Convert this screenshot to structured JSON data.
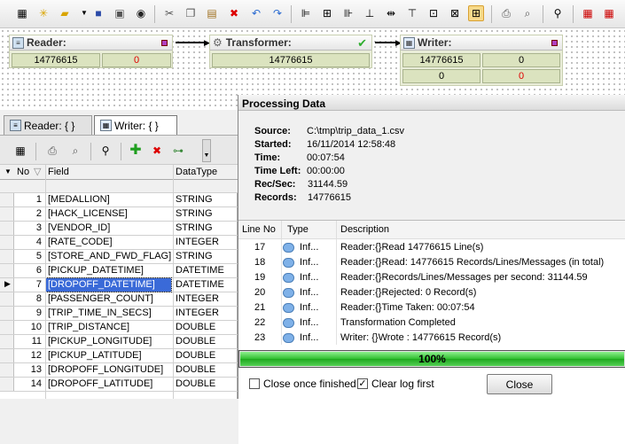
{
  "toolbar": {
    "icons": [
      "properties-icon",
      "new-icon",
      "open-icon",
      "save-icon",
      "save-as-icon",
      "deploy-icon",
      "cut-icon",
      "copy-icon",
      "paste-icon",
      "delete-icon",
      "undo-icon",
      "redo-icon",
      "align-left-icon",
      "align-center-icon",
      "align-right-icon",
      "align-bottom-icon",
      "distribute-h-icon",
      "align-top-icon",
      "distribute-v-icon",
      "size-icon",
      "fit-icon",
      "print-icon",
      "print-preview-icon",
      "find-icon",
      "calendar-icon",
      "calendar-2-icon"
    ]
  },
  "canvas": {
    "reader": {
      "title": "Reader:",
      "count": "14776615",
      "errors": "0"
    },
    "transformer": {
      "title": "Transformer:",
      "count": "14776615"
    },
    "writer": {
      "title": "Writer:",
      "count": "14776615",
      "c2": "0",
      "c3": "0",
      "c4": "0"
    }
  },
  "tabs": [
    {
      "label": "Reader: { }"
    },
    {
      "label": "Writer: { }"
    }
  ],
  "grid": {
    "headers": {
      "no": "No",
      "field": "Field",
      "type": "DataType"
    },
    "rows": [
      {
        "no": "1",
        "field": "[MEDALLION]",
        "type": "STRING"
      },
      {
        "no": "2",
        "field": "[HACK_LICENSE]",
        "type": "STRING"
      },
      {
        "no": "3",
        "field": "[VENDOR_ID]",
        "type": "STRING"
      },
      {
        "no": "4",
        "field": "[RATE_CODE]",
        "type": "INTEGER"
      },
      {
        "no": "5",
        "field": "[STORE_AND_FWD_FLAG]",
        "type": "STRING"
      },
      {
        "no": "6",
        "field": "[PICKUP_DATETIME]",
        "type": "DATETIME"
      },
      {
        "no": "7",
        "field": "[DROPOFF_DATETIME]",
        "type": "DATETIME"
      },
      {
        "no": "8",
        "field": "[PASSENGER_COUNT]",
        "type": "INTEGER"
      },
      {
        "no": "9",
        "field": "[TRIP_TIME_IN_SECS]",
        "type": "INTEGER"
      },
      {
        "no": "10",
        "field": "[TRIP_DISTANCE]",
        "type": "DOUBLE"
      },
      {
        "no": "11",
        "field": "[PICKUP_LONGITUDE]",
        "type": "DOUBLE"
      },
      {
        "no": "12",
        "field": "[PICKUP_LATITUDE]",
        "type": "DOUBLE"
      },
      {
        "no": "13",
        "field": "[DROPOFF_LONGITUDE]",
        "type": "DOUBLE"
      },
      {
        "no": "14",
        "field": "[DROPOFF_LATITUDE]",
        "type": "DOUBLE"
      }
    ]
  },
  "dialog": {
    "title": "Processing Data",
    "source_label": "Source:",
    "source": "C:\\tmp\\trip_data_1.csv",
    "started_label": "Started:",
    "started": "16/11/2014 12:58:48",
    "time_label": "Time:",
    "time": "00:07:54",
    "left_label": "Time Left:",
    "left": "00:00:00",
    "rec_label": "Rec/Sec:",
    "rec": "31144.59",
    "records_label": "Records:",
    "records": "14776615",
    "log_headers": {
      "line": "Line No",
      "type": "Type",
      "desc": "Description"
    },
    "log": [
      {
        "line": "17",
        "type": "Inf...",
        "desc": "Reader:{}Read 14776615 Line(s)"
      },
      {
        "line": "18",
        "type": "Inf...",
        "desc": "Reader:{}Read: 14776615 Records/Lines/Messages (in total)"
      },
      {
        "line": "19",
        "type": "Inf...",
        "desc": "Reader:{}Records/Lines/Messages per second: 31144.59"
      },
      {
        "line": "20",
        "type": "Inf...",
        "desc": "Reader:{}Rejected: 0 Record(s)"
      },
      {
        "line": "21",
        "type": "Inf...",
        "desc": "Reader:{}Time Taken: 00:07:54"
      },
      {
        "line": "22",
        "type": "Inf...",
        "desc": "Transformation Completed"
      },
      {
        "line": "23",
        "type": "Inf...",
        "desc": "Writer: {}Wrote : 14776615 Record(s)"
      }
    ],
    "progress": "100%",
    "progress_value": 1.0,
    "close_once_label": "Close once finished",
    "clear_log_label": "Clear log first",
    "close_button": "Close"
  }
}
